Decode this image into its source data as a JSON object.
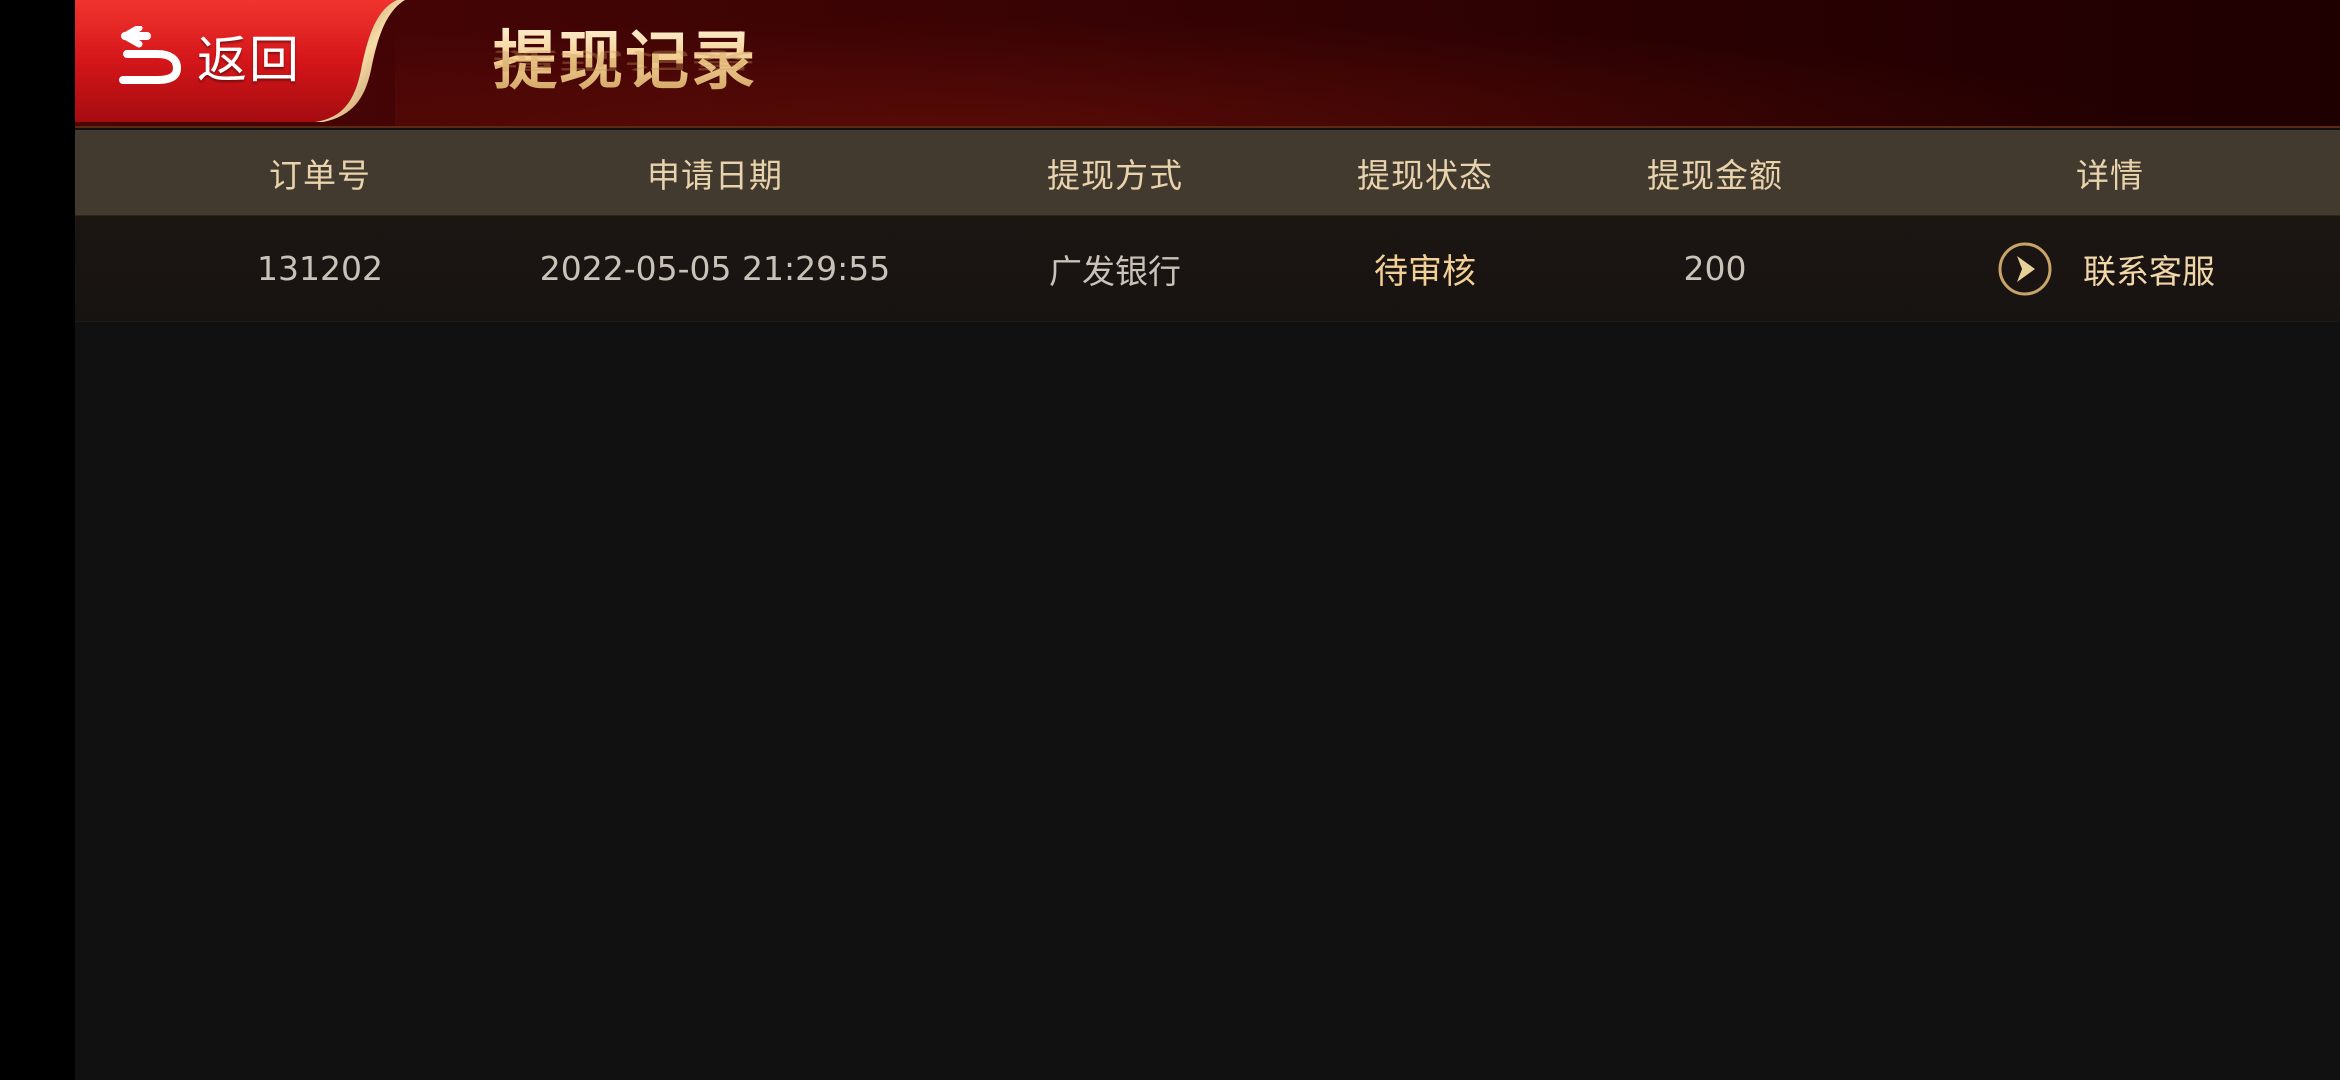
{
  "header": {
    "back_label": "返回",
    "title": "提现记录"
  },
  "table": {
    "columns": [
      "订单号",
      "申请日期",
      "提现方式",
      "提现状态",
      "提现金额",
      "详情"
    ],
    "rows": [
      {
        "order_no": "131202",
        "date": "2022-05-05 21:29:55",
        "method": "广发银行",
        "status": "待审核",
        "amount": "200",
        "detail": "联系客服"
      }
    ]
  },
  "colors": {
    "header_red": "#d4161a",
    "gold_text": "#f2cf94",
    "table_header_bg": "#433a2f",
    "page_bg": "#111111"
  },
  "icons": {
    "back": "return-arrow-icon",
    "detail": "circle-chevron-right-icon"
  }
}
